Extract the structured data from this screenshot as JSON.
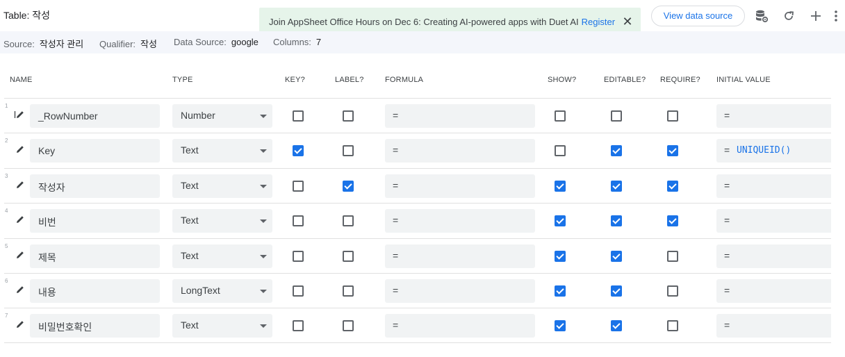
{
  "header": {
    "table_prefix": "Table:",
    "table_name": "작성",
    "notice": {
      "text": "Join AppSheet Office Hours on Dec 6: Creating AI-powered apps with Duet AI",
      "link": "Register",
      "close": "✕"
    },
    "view_data_source": "View data source",
    "icons": [
      "database-settings-icon",
      "refresh-icon",
      "add-icon",
      "more-vert-icon"
    ]
  },
  "info": {
    "source_label": "Source:",
    "source_value": "작성자 관리",
    "qualifier_label": "Qualifier:",
    "qualifier_value": "작성",
    "datasource_label": "Data Source:",
    "datasource_value": "google",
    "columns_label": "Columns:",
    "columns_value": "7"
  },
  "columns": {
    "name": "NAME",
    "type": "TYPE",
    "key": "KEY?",
    "label": "LABEL?",
    "formula": "FORMULA",
    "show": "SHOW?",
    "editable": "EDITABLE?",
    "require": "REQUIRE?",
    "initial_value": "INITIAL VALUE"
  },
  "rows": [
    {
      "num": "1",
      "name": "_RowNumber",
      "type": "Number",
      "key": false,
      "label": false,
      "formula": "=",
      "show": false,
      "editable": false,
      "require": false,
      "initial_eq": "=",
      "initial_expr": ""
    },
    {
      "num": "2",
      "name": "Key",
      "type": "Text",
      "key": true,
      "label": false,
      "formula": "=",
      "show": false,
      "editable": true,
      "require": true,
      "initial_eq": "=",
      "initial_expr": "UNIQUEID()"
    },
    {
      "num": "3",
      "name": "작성자",
      "type": "Text",
      "key": false,
      "label": true,
      "formula": "=",
      "show": true,
      "editable": true,
      "require": true,
      "initial_eq": "=",
      "initial_expr": ""
    },
    {
      "num": "4",
      "name": "비번",
      "type": "Text",
      "key": false,
      "label": false,
      "formula": "=",
      "show": true,
      "editable": true,
      "require": true,
      "initial_eq": "=",
      "initial_expr": ""
    },
    {
      "num": "5",
      "name": "제목",
      "type": "Text",
      "key": false,
      "label": false,
      "formula": "=",
      "show": true,
      "editable": true,
      "require": false,
      "initial_eq": "=",
      "initial_expr": ""
    },
    {
      "num": "6",
      "name": "내용",
      "type": "LongText",
      "key": false,
      "label": false,
      "formula": "=",
      "show": true,
      "editable": true,
      "require": false,
      "initial_eq": "=",
      "initial_expr": ""
    },
    {
      "num": "7",
      "name": "비밀번호확인",
      "type": "Text",
      "key": false,
      "label": false,
      "formula": "=",
      "show": true,
      "editable": true,
      "require": false,
      "initial_eq": "=",
      "initial_expr": ""
    }
  ],
  "colors": {
    "accent": "#1a73e8",
    "notice_bg": "#e6f4ea",
    "info_bg": "#f4f6fb",
    "field_bg": "#f1f3f4"
  }
}
